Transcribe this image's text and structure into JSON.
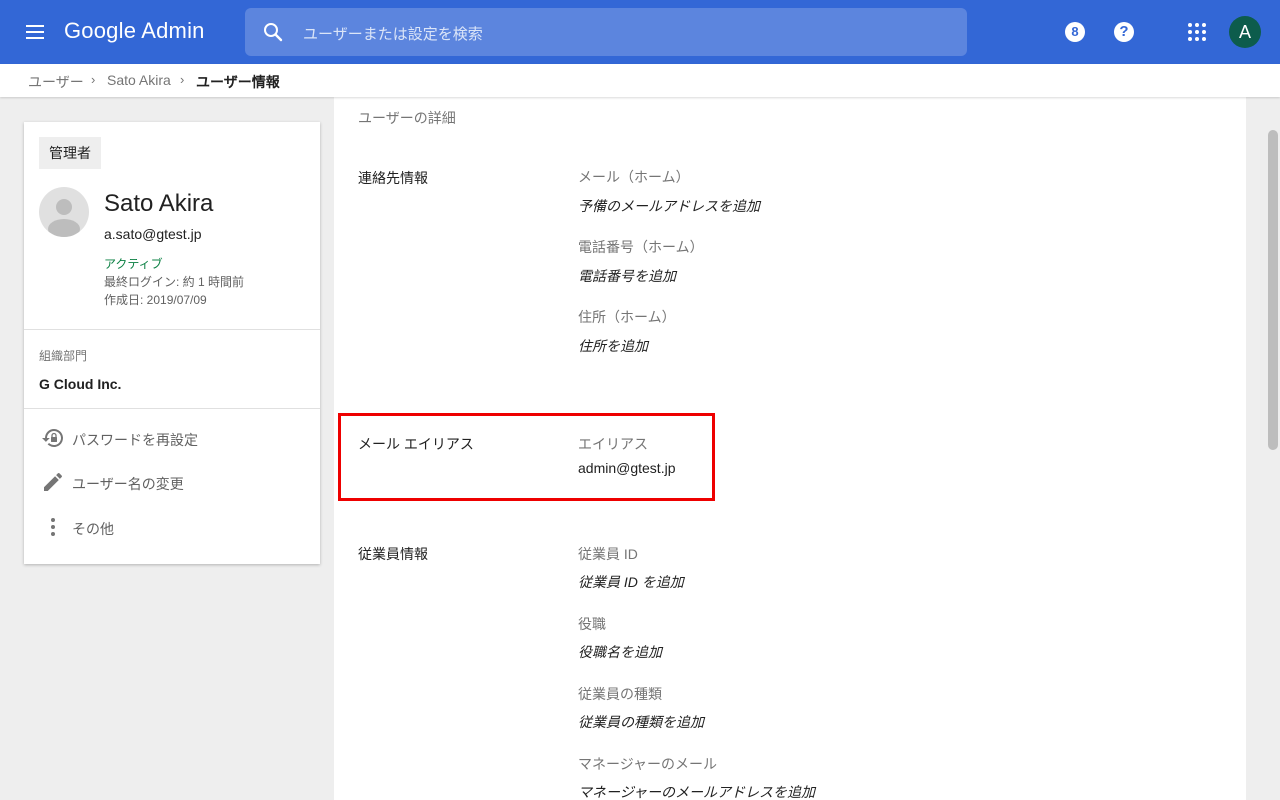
{
  "header": {
    "app_name": "Google Admin",
    "search_placeholder": "ユーザーまたは設定を検索",
    "account_initial": "A",
    "support_badge": "8",
    "help_symbol": "?"
  },
  "breadcrumb": {
    "items": [
      {
        "label": "ユーザー"
      },
      {
        "label": "Sato Akira"
      },
      {
        "label": "ユーザー情報"
      }
    ]
  },
  "user_card": {
    "role": "管理者",
    "name": "Sato Akira",
    "email": "a.sato@gtest.jp",
    "status": "アクティブ",
    "last_login": "最終ログイン: 約 1 時間前",
    "created": "作成日: 2019/07/09",
    "org_unit_label": "組織部門",
    "org_unit_value": "G Cloud Inc.",
    "actions": [
      {
        "label": "パスワードを再設定",
        "icon": "lock-reset-icon"
      },
      {
        "label": "ユーザー名の変更",
        "icon": "pencil-icon"
      },
      {
        "label": "その他",
        "icon": "more-vert-icon"
      }
    ]
  },
  "details": {
    "title": "ユーザーの詳細",
    "contact": {
      "label": "連絡先情報",
      "fields": [
        {
          "label": "メール（ホーム）",
          "value": "予備のメールアドレスを追加"
        },
        {
          "label": "電話番号（ホーム）",
          "value": "電話番号を追加"
        },
        {
          "label": "住所（ホーム）",
          "value": "住所を追加"
        }
      ]
    },
    "alias": {
      "label": "メール エイリアス",
      "field_label": "エイリアス",
      "value": "admin@gtest.jp"
    },
    "employee": {
      "label": "従業員情報",
      "fields": [
        {
          "label": "従業員 ID",
          "value": "従業員 ID を追加"
        },
        {
          "label": "役職",
          "value": "役職名を追加"
        },
        {
          "label": "従業員の種類",
          "value": "従業員の種類を追加"
        },
        {
          "label": "マネージャーのメール",
          "value": "マネージャーのメールアドレスを追加"
        }
      ]
    }
  },
  "colors": {
    "topbar": "#3367d6",
    "active_status": "#0b8043",
    "highlight_border": "#ee0000"
  }
}
